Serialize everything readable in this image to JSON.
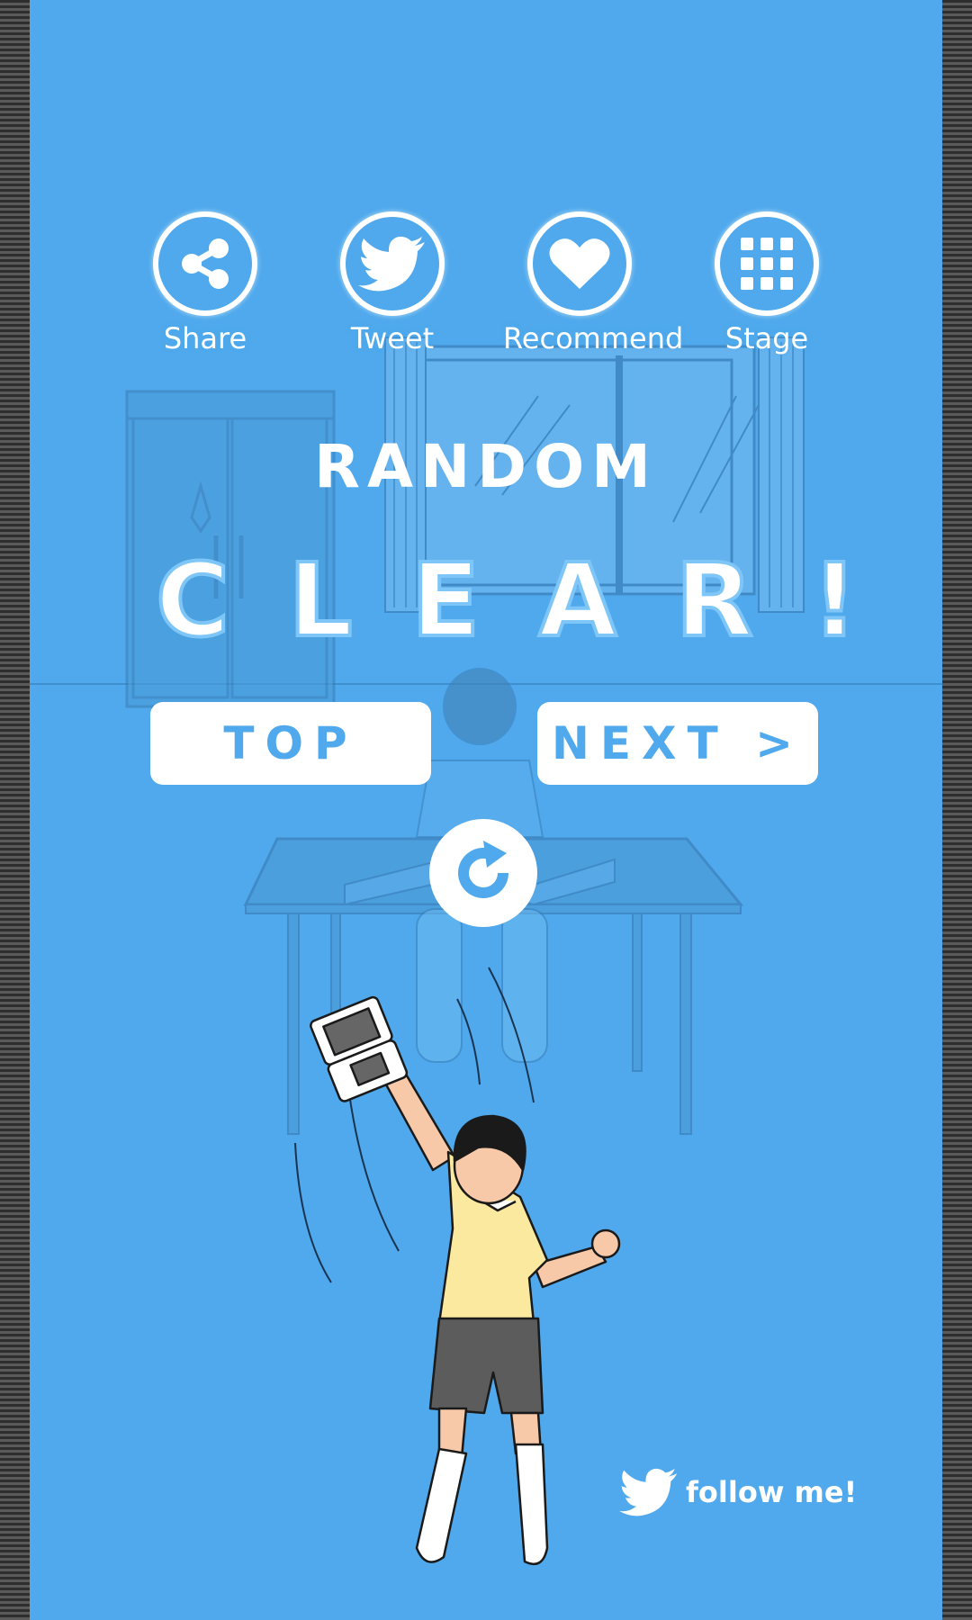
{
  "actions": {
    "share_label": "Share",
    "tweet_label": "Tweet",
    "recommend_label": "Recommend",
    "stage_label": "Stage"
  },
  "result": {
    "mode": "RANDOM",
    "status_letters": [
      "C",
      "L",
      "E",
      "A",
      "R",
      "!"
    ]
  },
  "buttons": {
    "top_label": "TOP",
    "next_label": "NEXT >"
  },
  "footer": {
    "follow_label": "follow me!"
  },
  "colors": {
    "background": "#4fa9ec",
    "accent": "#ffffff",
    "shirt": "#fbe9a0",
    "shorts": "#5c5c5c"
  }
}
